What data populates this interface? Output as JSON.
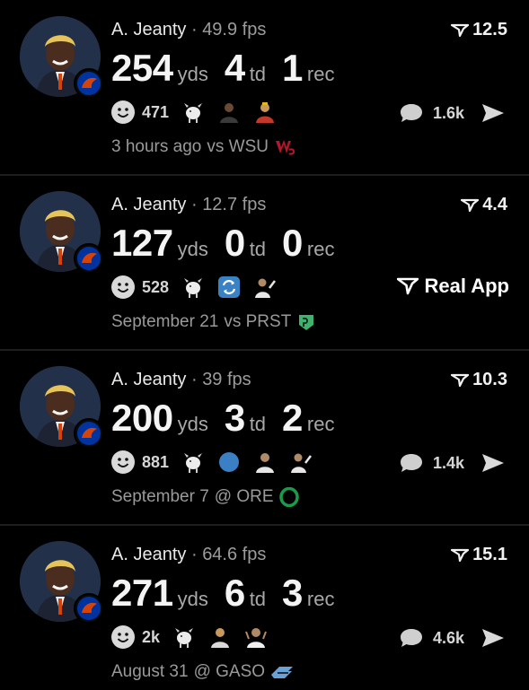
{
  "posts": [
    {
      "player": "A. Jeanty",
      "separator": "·",
      "fps": "49.9 fps",
      "score": "12.5",
      "yds": "254",
      "yds_label": "yds",
      "td": "4",
      "td_label": "td",
      "rec": "1",
      "rec_label": "rec",
      "reactions": "471",
      "comments": "1.6k",
      "time": "3 hours ago",
      "opponent": "vs WSU",
      "opponent_color": "#b5162c"
    },
    {
      "player": "A. Jeanty",
      "separator": "·",
      "fps": "12.7 fps",
      "score": "4.4",
      "yds": "127",
      "yds_label": "yds",
      "td": "0",
      "td_label": "td",
      "rec": "0",
      "rec_label": "rec",
      "reactions": "528",
      "time": "September 21",
      "opponent": "vs PRST",
      "opponent_color": "#3fb26f",
      "brand": "Real App"
    },
    {
      "player": "A. Jeanty",
      "separator": "·",
      "fps": "39 fps",
      "score": "10.3",
      "yds": "200",
      "yds_label": "yds",
      "td": "3",
      "td_label": "td",
      "rec": "2",
      "rec_label": "rec",
      "reactions": "881",
      "comments": "1.4k",
      "time": "September 7",
      "opponent": "@ ORE",
      "opponent_color": "#1a9b4b"
    },
    {
      "player": "A. Jeanty",
      "separator": "·",
      "fps": "64.6 fps",
      "score": "15.1",
      "yds": "271",
      "yds_label": "yds",
      "td": "6",
      "td_label": "td",
      "rec": "3",
      "rec_label": "rec",
      "reactions": "2k",
      "comments": "4.6k",
      "time": "August 31",
      "opponent": "@ GASO",
      "opponent_color": "#6aa2d8"
    }
  ],
  "colors": {
    "background": "#000000",
    "separator": "#1e1e1e",
    "boise_orange": "#d64309",
    "boise_blue": "#0033a0"
  }
}
